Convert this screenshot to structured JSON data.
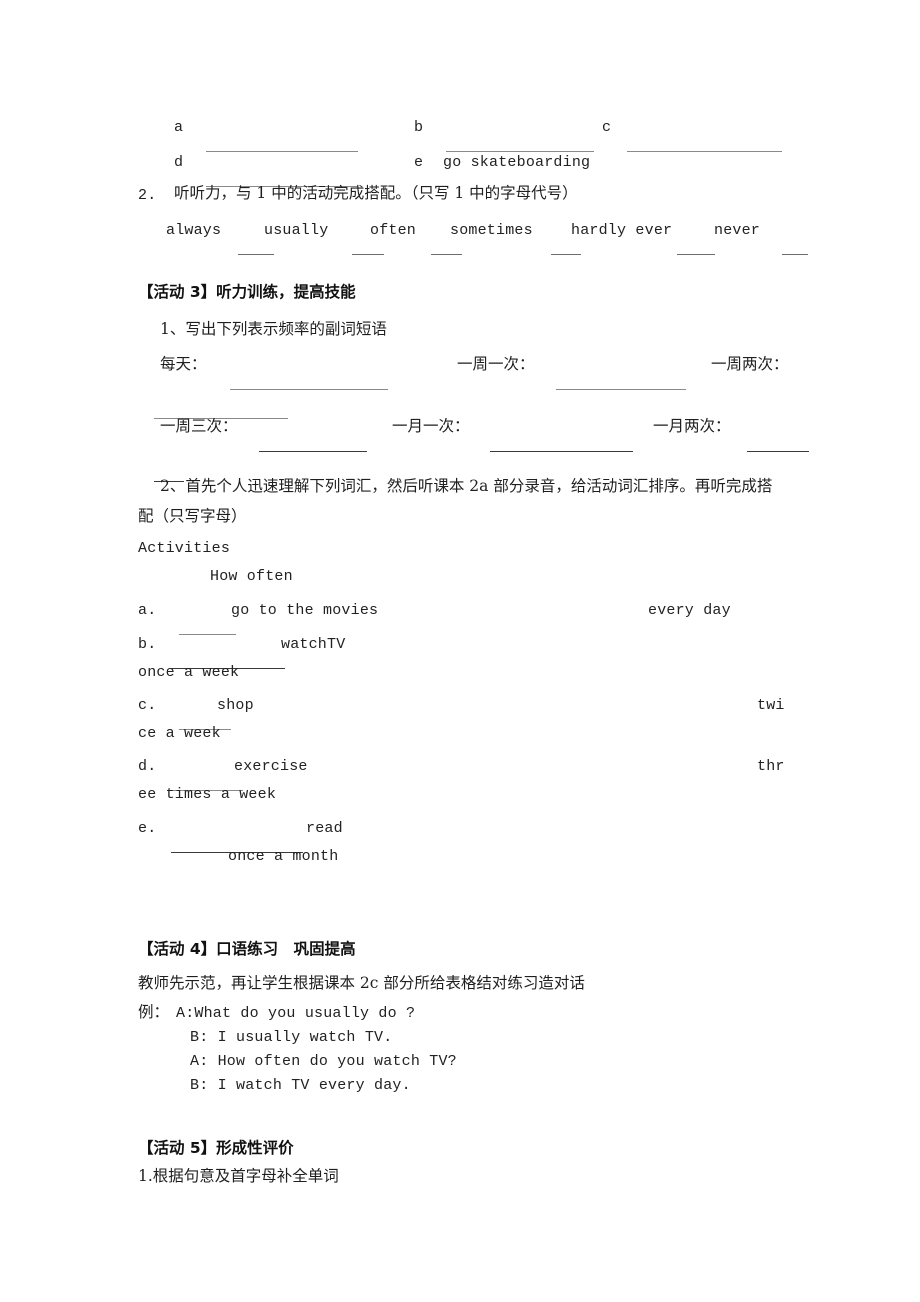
{
  "document": {
    "type": "worksheet",
    "language": "zh-CN + en",
    "page_background": "#ffffff",
    "text_color": "#1f1f1f"
  },
  "activity1_answers": {
    "row1": {
      "a_label": "a",
      "b_label": "b",
      "c_label": "c"
    },
    "row2": {
      "d_label": "d",
      "e_label": "e",
      "e_value": "go skateboarding"
    }
  },
  "item2": {
    "number": "2.",
    "instruction": "听听力，与 1 中的活动完成搭配。（只写 1 中的字母代号）",
    "adverbs": [
      "always",
      "usually",
      "often",
      "sometimes",
      "hardly ever",
      "never"
    ]
  },
  "activity3": {
    "heading": "【活动 3】听力训练，提高技能",
    "task1_label": "1、写出下列表示频率的副词短语",
    "frequency_prompts_row1": [
      "每天：",
      "一周一次：",
      "一周两次："
    ],
    "frequency_prompts_row2": [
      "一周三次：",
      "一月一次：",
      "一月两次："
    ],
    "task2_label_line1": "2、首先个人迅速理解下列词汇，然后听课本 2a 部分录音，给活动词汇排序。再听完成搭",
    "task2_label_line2": "配（只写字母）",
    "table_headers": {
      "activities": "Activities",
      "how_often": "How often"
    },
    "rows": [
      {
        "marker": "a.",
        "activity": "go to the movies",
        "frequency": "every day",
        "frequency_wrap": ""
      },
      {
        "marker": "b.",
        "activity": "watchTV",
        "frequency": "",
        "frequency_wrap": "once a week"
      },
      {
        "marker": "c.",
        "activity": "shop",
        "frequency": "twi",
        "frequency_wrap": "ce a week"
      },
      {
        "marker": "d.",
        "activity": "exercise",
        "frequency": "thr",
        "frequency_wrap": "ee times a week"
      },
      {
        "marker": "e.",
        "activity": "read",
        "frequency": "",
        "frequency_wrap": "once a month"
      }
    ]
  },
  "activity4": {
    "heading": "【活动 4】口语练习　巩固提高",
    "instruction": "教师先示范，再让学生根据课本 2c 部分所给表格结对练习造对话",
    "example_label": "例：",
    "dialogue": [
      "A:What do you usually do ?",
      "B: I usually watch TV.",
      "A: How often do you watch TV?",
      "B: I watch TV every day."
    ]
  },
  "activity5": {
    "heading": "【活动 5】形成性评价",
    "task1": "1.根据句意及首字母补全单词"
  }
}
